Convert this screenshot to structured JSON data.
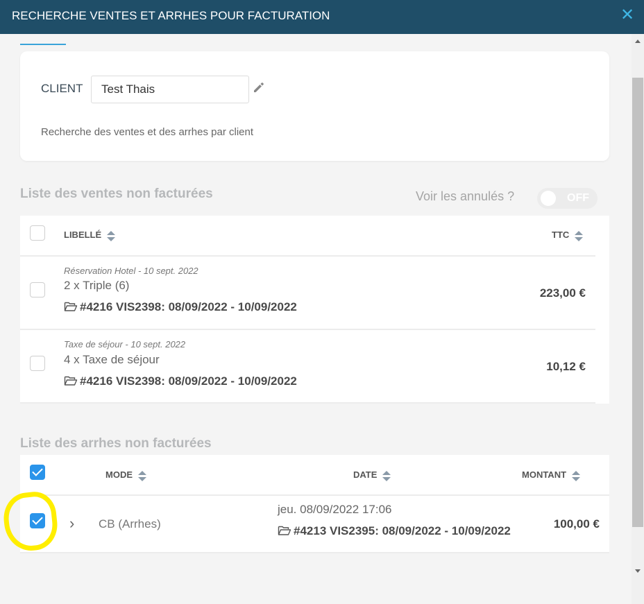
{
  "header": {
    "title": "RECHERCHE VENTES ET ARRHES POUR FACTURATION",
    "close_icon": "close-icon"
  },
  "client": {
    "label": "CLIENT",
    "value": "Test Thais",
    "help": "Recherche des ventes et des arrhes par client"
  },
  "sales": {
    "title": "Liste des ventes non facturées",
    "show_cancelled_label": "Voir les annulés ?",
    "toggle_state": "OFF",
    "columns": {
      "label": "LIBELLÉ",
      "ttc": "TTC"
    },
    "rows": [
      {
        "category": "Réservation Hotel - 10 sept. 2022",
        "description": "2 x Triple (6)",
        "ref": "#4216 VIS2398: 08/09/2022 - 10/09/2022",
        "amount": "223,00 €",
        "checked": false
      },
      {
        "category": "Taxe de séjour - 10 sept. 2022",
        "description": "4 x Taxe de séjour",
        "ref": "#4216 VIS2398: 08/09/2022 - 10/09/2022",
        "amount": "10,12 €",
        "checked": false
      }
    ]
  },
  "deposits": {
    "title": "Liste des arrhes non facturées",
    "columns": {
      "mode": "MODE",
      "date": "DATE",
      "amount": "MONTANT"
    },
    "header_checked": true,
    "rows": [
      {
        "mode": "CB (Arrhes)",
        "date": "jeu. 08/09/2022 17:06",
        "ref": "#4213 VIS2395: 08/09/2022 - 10/09/2022",
        "amount": "100,00 €",
        "checked": true
      }
    ]
  },
  "colors": {
    "header_bg": "#1f4e68",
    "accent": "#2a94ea",
    "close": "#3fb7e6",
    "highlight": "#ffee00"
  }
}
